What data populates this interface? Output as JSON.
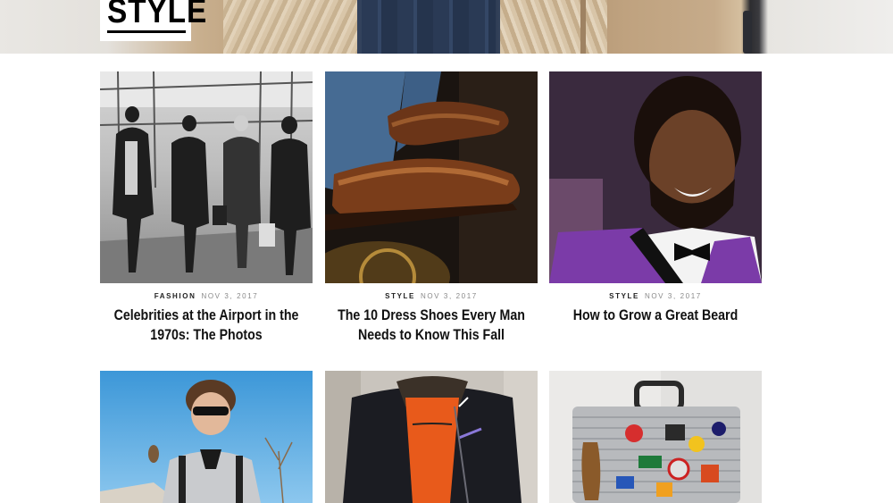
{
  "site": {
    "section_logo": "STYLE"
  },
  "articles": [
    {
      "category": "FASHION",
      "date": "NOV 3, 2017",
      "title": "Celebrities at the Airport in the 1970s: The Photos",
      "image": "black-and-white photo of four people walking through an airport corridor"
    },
    {
      "category": "STYLE",
      "date": "NOV 3, 2017",
      "title": "The 10 Dress Shoes Every Man Needs to Know This Fall",
      "image": "brown leather dress shoes with blue trousers"
    },
    {
      "category": "STYLE",
      "date": "NOV 3, 2017",
      "title": "How to Grow a Great Beard",
      "image": "smiling bearded man in purple velvet jacket and bow tie"
    }
  ],
  "second_row": [
    {
      "image": "man in sunglasses with backpack against blue sky"
    },
    {
      "image": "man in black shearling leather jacket and orange sweater"
    },
    {
      "image": "silver aluminum suitcase covered in stickers"
    }
  ]
}
